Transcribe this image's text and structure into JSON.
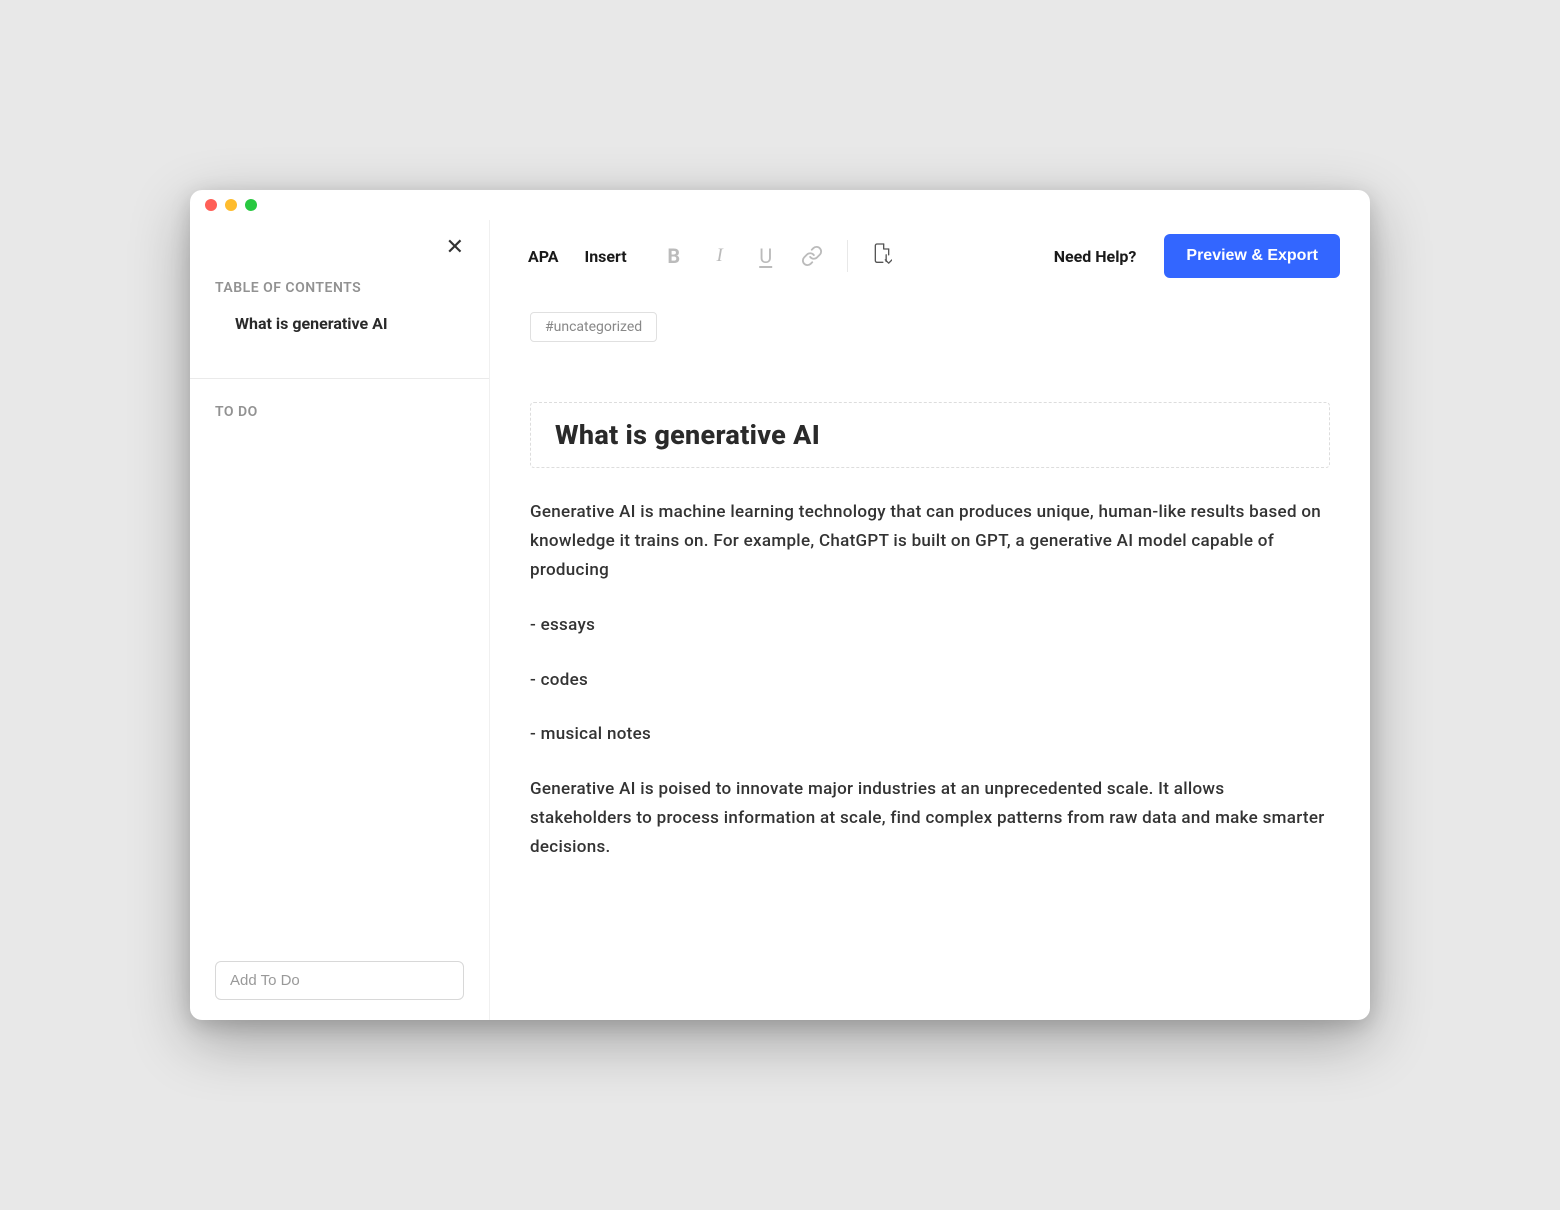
{
  "sidebar": {
    "toc_label": "TABLE OF CONTENTS",
    "toc_items": [
      "What is generative AI"
    ],
    "todo_label": "TO DO",
    "todo_placeholder": "Add To Do"
  },
  "toolbar": {
    "format_style": "APA",
    "insert_label": "Insert",
    "help_label": "Need Help?",
    "export_label": "Preview & Export"
  },
  "document": {
    "tag": "#uncategorized",
    "title": "What is generative AI",
    "paragraphs": [
      "Generative AI is machine learning technology that can produces unique, human-like results based on knowledge it trains on. For example, ChatGPT is built on GPT, a generative AI model capable of producing",
      "- essays",
      "- codes",
      "- musical notes",
      "Generative AI is poised to innovate major industries at an unprecedented scale. It allows stakeholders to process information at scale, find complex patterns from raw data and make smarter decisions."
    ]
  }
}
